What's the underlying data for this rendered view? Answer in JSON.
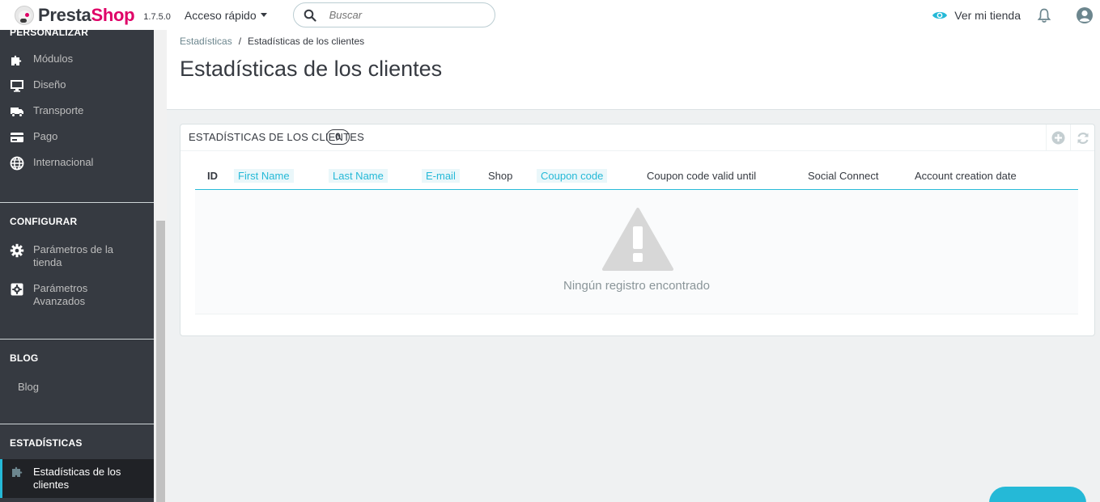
{
  "header": {
    "logo_text_1": "Presta",
    "logo_text_2": "Shop",
    "version": "1.7.5.0",
    "quick_access": "Acceso rápido",
    "search_placeholder": "Buscar",
    "view_shop": "Ver mi tienda"
  },
  "sidebar": {
    "sections": [
      {
        "title": "PERSONALIZAR"
      },
      {
        "title": "CONFIGURAR"
      },
      {
        "title": "BLOG"
      },
      {
        "title": "ESTADÍSTICAS"
      }
    ],
    "items": [
      {
        "label": "Módulos",
        "icon": "puzzle-icon"
      },
      {
        "label": "Diseño",
        "icon": "monitor-icon"
      },
      {
        "label": "Transporte",
        "icon": "truck-icon"
      },
      {
        "label": "Pago",
        "icon": "credit-card-icon"
      },
      {
        "label": "Internacional",
        "icon": "globe-icon"
      },
      {
        "label": "Parámetros de la tienda",
        "icon": "gear-icon"
      },
      {
        "label": "Parámetros Avanzados",
        "icon": "gear-box-icon"
      },
      {
        "label": "Blog",
        "icon": ""
      },
      {
        "label": "Estadísticas de los clientes",
        "icon": "puzzle-icon",
        "active": true
      }
    ]
  },
  "breadcrumb": {
    "parent": "Estadísticas",
    "separator": "/",
    "current": "Estadísticas de los clientes"
  },
  "page_title": "Estadísticas de los clientes",
  "panel": {
    "title": "ESTADÍSTICAS DE LOS CLIENTES",
    "count": "0",
    "columns": [
      "ID",
      "First Name",
      "Last Name",
      "E-mail",
      "Shop",
      "Coupon code",
      "Coupon code valid until",
      "Social Connect",
      "Account creation date"
    ],
    "empty_message": "Ningún registro encontrado"
  },
  "colors": {
    "accent": "#25b9d7",
    "brand": "#df0067",
    "sidebar_bg": "#363a41"
  }
}
